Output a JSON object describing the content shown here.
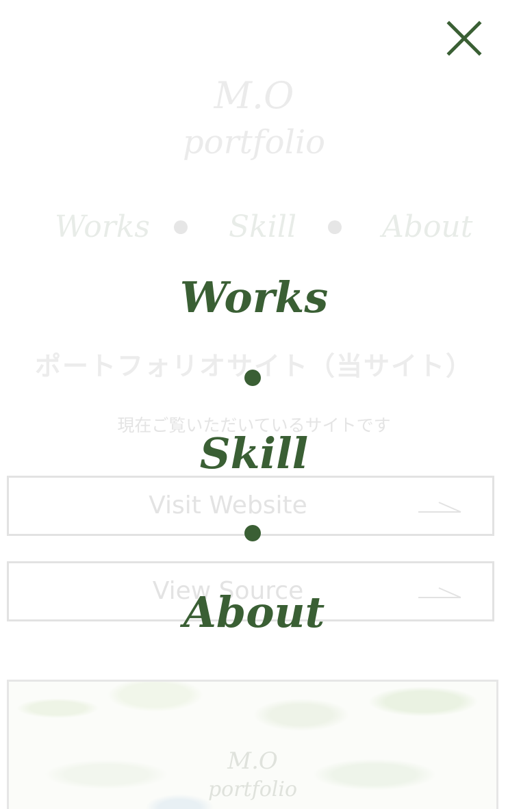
{
  "logo": {
    "line1": "M.O",
    "line2": "portfolio"
  },
  "nav": {
    "items": [
      {
        "label": "Works"
      },
      {
        "label": "Skill"
      },
      {
        "label": "About"
      }
    ]
  },
  "project": {
    "title": "ポートフォリオサイト（当サイト）",
    "description": "現在ご覧いただいているサイトです",
    "visit_label": "Visit Website",
    "source_label": "View Source"
  },
  "card": {
    "line1": "M.O",
    "line2": "portfolio"
  },
  "menu": {
    "items": [
      {
        "label": "Works"
      },
      {
        "label": "Skill"
      },
      {
        "label": "About"
      }
    ],
    "close_icon": "close-icon"
  },
  "colors": {
    "accent": "#3a5f34",
    "faded_text": "#ebebeb",
    "background": "#ffffff"
  }
}
